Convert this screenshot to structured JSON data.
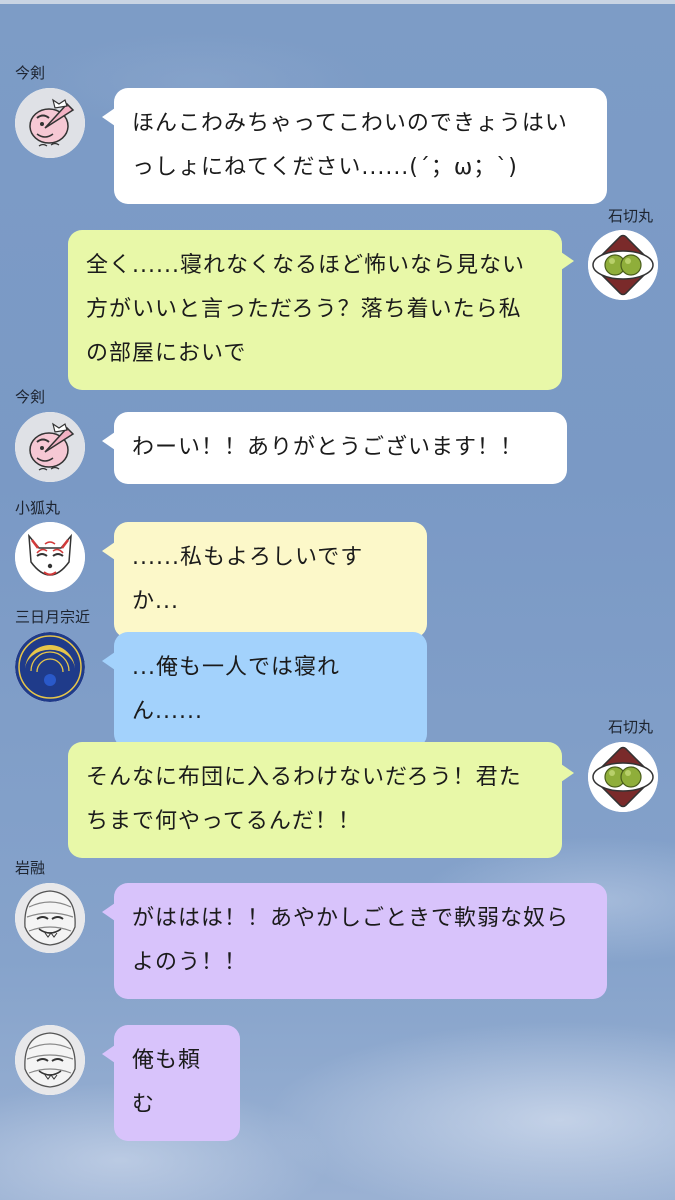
{
  "messages": [
    {
      "sender": "今剣",
      "avatar_icon": "tengu-mask-icon",
      "side": "left",
      "color": "#ffffff",
      "text": "ほんこわみちゃってこわいのできょうはいっしょにねてください......(´；ω；`)"
    },
    {
      "sender": "石切丸",
      "avatar_icon": "dango-plate-icon",
      "side": "right",
      "color": "#e8f8a8",
      "text": "全く......寝れなくなるほど怖いなら見ない方がいいと言っただろう？落ち着いたら私の部屋においで"
    },
    {
      "sender": "今剣",
      "avatar_icon": "tengu-mask-icon",
      "side": "left",
      "color": "#ffffff",
      "text": "わーい！！ありがとうございます！！"
    },
    {
      "sender": "小狐丸",
      "avatar_icon": "fox-mask-icon",
      "side": "left",
      "color": "#fcf8c9",
      "text": "......私もよろしいですか..."
    },
    {
      "sender": "三日月宗近",
      "avatar_icon": "crescent-crest-icon",
      "side": "left",
      "color": "#a3d2fc",
      "text": "...俺も一人では寝れん......"
    },
    {
      "sender": "石切丸",
      "avatar_icon": "dango-plate-icon",
      "side": "right",
      "color": "#e8f8a8",
      "text": "そんなに布団に入るわけないだろう！君たちまで何やってるんだ！！"
    },
    {
      "sender": "岩融",
      "avatar_icon": "hooded-monk-icon",
      "side": "left",
      "color": "#d8c3fb",
      "text": "がははは！！あやかしごときで軟弱な奴らよのう！！"
    },
    {
      "sender": "",
      "avatar_icon": "hooded-monk-icon",
      "side": "left",
      "color": "#d8c3fb",
      "text": "俺も頼む"
    }
  ]
}
